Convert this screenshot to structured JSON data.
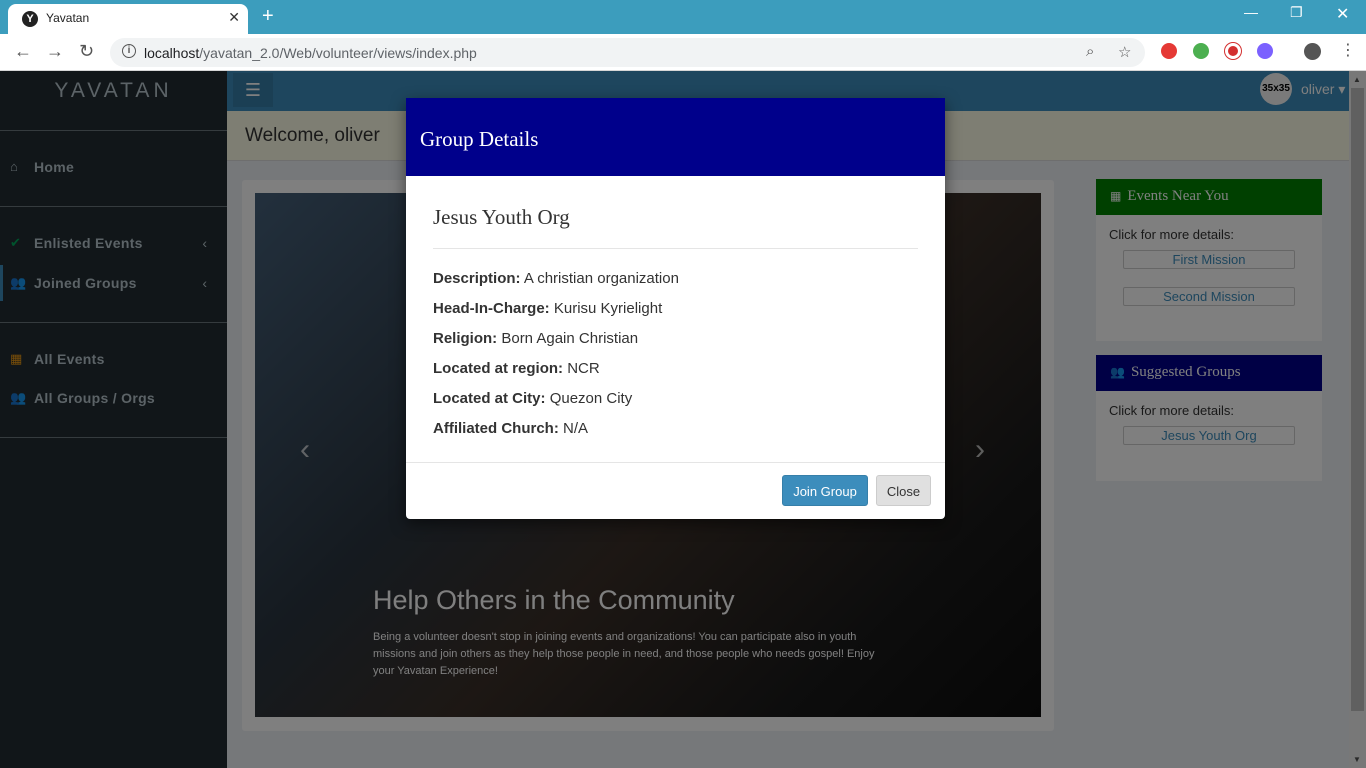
{
  "browser": {
    "tab_title": "Yavatan",
    "tab_favicon": "Y",
    "url_host": "localhost",
    "url_path": "/yavatan_2.0/Web/volunteer/views/index.php"
  },
  "sidebar": {
    "logo": "YAVATAN",
    "items": [
      {
        "label": "Home",
        "icon": "home-icon"
      },
      {
        "label": "Enlisted Events",
        "icon": "check-icon"
      },
      {
        "label": "Joined Groups",
        "icon": "users-icon"
      },
      {
        "label": "All Events",
        "icon": "calendar-icon"
      },
      {
        "label": "All Groups / Orgs",
        "icon": "users-icon"
      }
    ]
  },
  "topnav": {
    "avatar_text": "35x35",
    "user": "oliver"
  },
  "welcome": "Welcome, oliver",
  "carousel": {
    "title": "Help Others in the Community",
    "text": "Being a volunteer doesn't stop in joining events and organizations! You can participate also in youth missions and join others as they help those people in need, and those people who needs gospel! Enjoy your Yavatan Experience!"
  },
  "events_box": {
    "title": "Events Near You",
    "hint": "Click for more details:",
    "items": [
      "First Mission",
      "Second Mission"
    ],
    "color": "#008000"
  },
  "groups_box": {
    "title": "Suggested Groups",
    "hint": "Click for more details:",
    "items": [
      "Jesus Youth Org"
    ],
    "color": "#00008b"
  },
  "modal": {
    "title": "Group Details",
    "group_name": "Jesus Youth Org",
    "details": [
      {
        "label": "Description:",
        "value": "A christian organization"
      },
      {
        "label": "Head-In-Charge:",
        "value": "Kurisu Kyrielight"
      },
      {
        "label": "Religion:",
        "value": "Born Again Christian"
      },
      {
        "label": "Located at region:",
        "value": "NCR"
      },
      {
        "label": "Located at City:",
        "value": "Quezon City"
      },
      {
        "label": "Affiliated Church:",
        "value": "N/A"
      }
    ],
    "join_label": "Join Group",
    "close_label": "Close"
  }
}
